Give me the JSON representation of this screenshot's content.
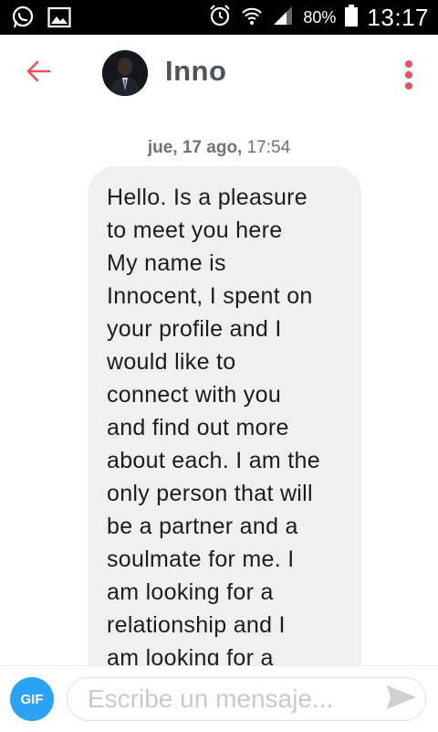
{
  "status_bar": {
    "battery": "80%",
    "time": "13:17",
    "left_icons": [
      "whatsapp-icon",
      "gallery-icon"
    ],
    "right_icons": [
      "alarm-icon",
      "wifi-icon",
      "signal-icon",
      "battery-icon"
    ]
  },
  "header": {
    "contact_name": "Inno",
    "back_icon": "arrow-left-icon",
    "menu_icon": "more-vertical-icon",
    "accent_color": "#e8505b"
  },
  "conversation": {
    "timestamp_date": "jue, 17 ago,",
    "timestamp_time": "17:54",
    "messages": [
      {
        "text": "Hello. Is a pleasure\nto meet you here\nMy name is\nInnocent, I spent on\nyour profile and I\nwould like to\nconnect with you\nand find out more\nabout each. I am the\nonly person that will\nbe a partner and a\nsoulmate for me. I\nam looking for a\nrelationship and I\nam looking for a"
      }
    ]
  },
  "composer": {
    "gif_label": "GIF",
    "placeholder": "Escribe un mensaje...",
    "value": "",
    "send_icon": "send-icon",
    "gif_color": "#2aa3f5"
  }
}
